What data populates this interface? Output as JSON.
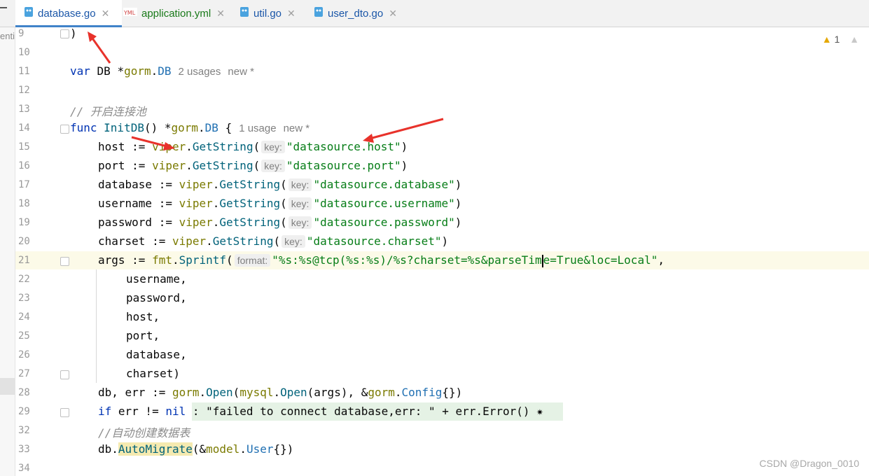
{
  "tabs": [
    {
      "label": "database.go",
      "icon": "go-file-icon",
      "active": true
    },
    {
      "label": "application.yml",
      "icon": "yml-file-icon",
      "active": false
    },
    {
      "label": "util.go",
      "icon": "go-file-icon",
      "active": false
    },
    {
      "label": "user_dto.go",
      "icon": "go-file-icon",
      "active": false
    }
  ],
  "side_text": "enti",
  "warnings": {
    "count": "1"
  },
  "line_numbers": [
    "9",
    "10",
    "11",
    "12",
    "13",
    "14",
    "15",
    "16",
    "17",
    "18",
    "19",
    "20",
    "21",
    "22",
    "23",
    "24",
    "25",
    "26",
    "27",
    "28",
    "29",
    "32",
    "33",
    "34"
  ],
  "code": {
    "l9": ")",
    "l11_kw": "var",
    "l11_name": " DB *",
    "l11_pkg": "gorm",
    "l11_dot": ".",
    "l11_type": "DB",
    "l11_usage": "2 usages",
    "l11_new": "new *",
    "l13": "// 开启连接池",
    "l14_kw": "func",
    "l14_fn": " InitDB",
    "l14_rest": "() *",
    "l14_pkg": "gorm",
    "l14_dot": ".",
    "l14_type": "DB",
    "l14_brace": " {",
    "l14_usage": "1 usage",
    "l14_new": "new *",
    "key_hint": "key:",
    "format_hint": "format:",
    "viper": "viper",
    "getstring": "GetString",
    "l15_var": "host := ",
    "l15_str": "\"datasource.host\"",
    "l16_var": "port := ",
    "l16_str": "\"datasource.port\"",
    "l17_var": "database := ",
    "l17_str": "\"datasource.database\"",
    "l18_var": "username := ",
    "l18_str": "\"datasource.username\"",
    "l19_var": "password := ",
    "l19_str": "\"datasource.password\"",
    "l20_var": "charset := ",
    "l20_str": "\"datasource.charset\"",
    "l21_var": "args := ",
    "l21_pkg": "fmt",
    "l21_fn": "Sprintf",
    "l21_str_a": "\"%s:%s@tcp(%s:%s)/%s?charset=%s&parseTim",
    "l21_str_b": "e=True&loc=Local\"",
    "l21_end": ",",
    "l22": "username,",
    "l23": "password,",
    "l24": "host,",
    "l25": "port,",
    "l26": "database,",
    "l27": "charset)",
    "l28_a": "db, err := ",
    "l28_gorm": "gorm",
    "l28_open": "Open",
    "l28_mysql": "mysql",
    "l28_open2": "Open",
    "l28_mid": "(args), &",
    "l28_gorm2": "gorm",
    "l28_config": "Config",
    "l28_end": "{})",
    "l29_if": "if",
    "l29_a": " err != ",
    "l29_nil": "nil",
    "l29_fold": " : \"failed to connect database,err: \" + err.Error() ✷",
    "l32": "//自动创建数据表",
    "l33_a": "db.",
    "l33_fn": "AutoMigrate",
    "l33_b": "(&",
    "l33_model": "model",
    "l33_dot": ".",
    "l33_type": "User",
    "l33_c": "{})"
  },
  "watermark": "CSDN @Dragon_0010",
  "colors": {
    "keyword": "#0033b3",
    "string": "#067d17",
    "arrow": "#e8322b",
    "tab_underline": "#4083c9"
  }
}
